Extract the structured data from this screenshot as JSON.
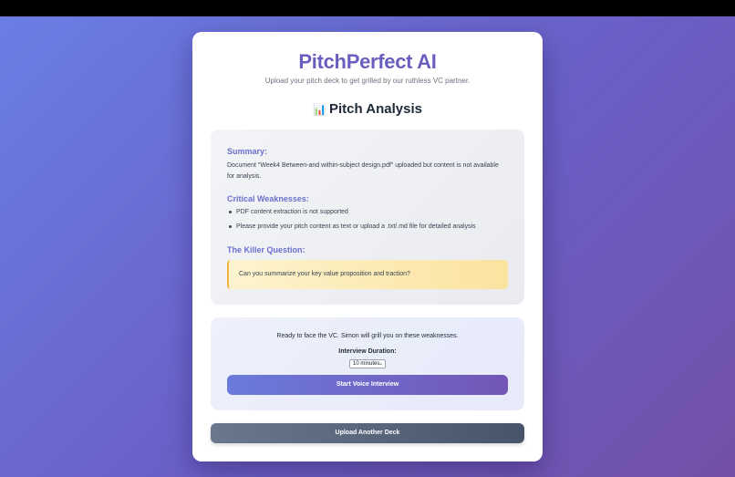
{
  "app": {
    "title": "PitchPerfect AI",
    "subtitle": "Upload your pitch deck to get grilled by our ruthless VC partner."
  },
  "analysis": {
    "heading_icon": "bar-chart-emoji",
    "heading_emoji": "📊",
    "heading": "Pitch Analysis",
    "summary_label": "Summary:",
    "summary_text": "Document \"Week4 Between-and within-subject design.pdf\" uploaded but content is not available for analysis.",
    "weaknesses_label": "Critical Weaknesses:",
    "weaknesses": [
      "PDF content extraction is not supported",
      "Please provide your pitch content as text or upload a .txt/.md file for detailed analysis"
    ],
    "killer_label": "The Killer Question:",
    "killer_question": "Can you summarize your key value proposition and traction?"
  },
  "interview": {
    "ready_text": "Ready to face the VC. Simon will grill you on these weaknesses.",
    "duration_label": "Interview Duration:",
    "duration_selected": "10 minutes",
    "start_label": "Start Voice Interview"
  },
  "actions": {
    "upload_another_label": "Upload Another Deck"
  },
  "colors": {
    "accent": "#6a5fc0",
    "background_start": "#6a7fe6",
    "background_end": "#7350a8",
    "question_border": "#f4b43c"
  }
}
